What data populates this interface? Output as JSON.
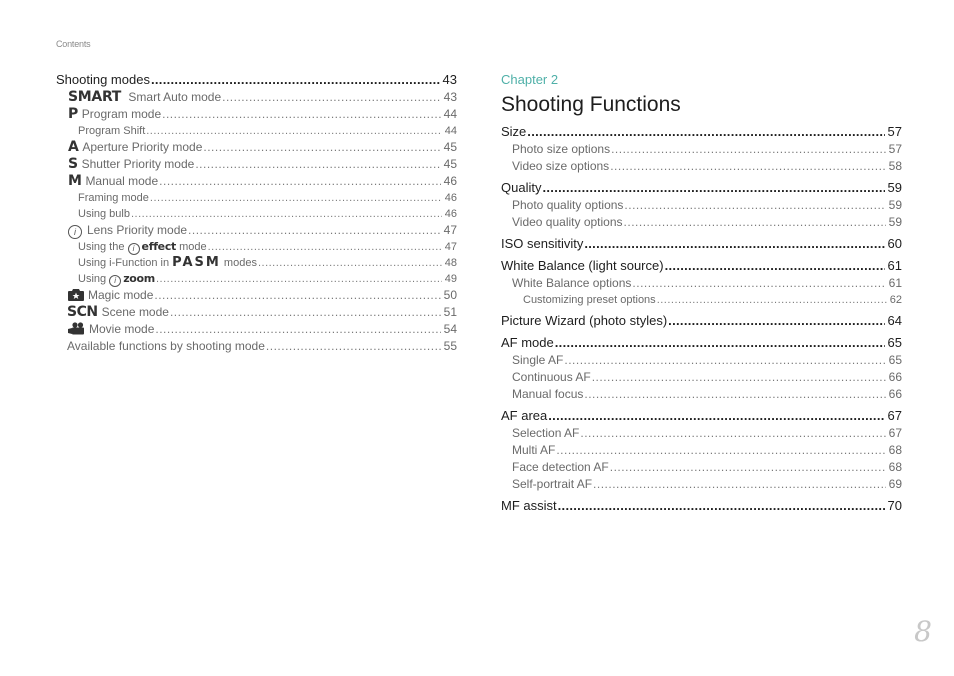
{
  "header": {
    "label": "Contents"
  },
  "left": {
    "heading": {
      "label": "Shooting modes",
      "page": "43"
    },
    "items": {
      "smart": {
        "icon": "SMART",
        "label": "Smart Auto mode",
        "page": "43"
      },
      "program": {
        "icon": "P",
        "label": "Program mode",
        "page": "44"
      },
      "shift": {
        "label": "Program Shift",
        "page": "44"
      },
      "aperture": {
        "icon": "A",
        "label": "Aperture Priority mode",
        "page": "45"
      },
      "shutter": {
        "icon": "S",
        "label": "Shutter Priority mode",
        "page": "45"
      },
      "manual": {
        "icon": "M",
        "label": "Manual mode",
        "page": "46"
      },
      "framing": {
        "label": "Framing mode",
        "page": "46"
      },
      "bulb": {
        "label": "Using bulb",
        "page": "46"
      },
      "lens": {
        "icon": "i",
        "label": "Lens Priority mode",
        "page": "47"
      },
      "effect": {
        "prefix": "Using the",
        "icon": "i",
        "bold": "effect",
        "suffix": "mode",
        "page": "47"
      },
      "ifunction": {
        "prefix": "Using i-Function in",
        "bold": "PASM",
        "suffix": "modes",
        "page": "48"
      },
      "zoom": {
        "prefix": "Using",
        "icon": "i",
        "bold": "zoom",
        "page": "49"
      },
      "magic": {
        "label": "Magic mode",
        "page": "50"
      },
      "scene": {
        "icon": "SCN",
        "label": "Scene mode",
        "page": "51"
      },
      "movie": {
        "label": "Movie mode",
        "page": "54"
      },
      "available": {
        "label": "Available functions by shooting mode",
        "page": "55"
      }
    }
  },
  "right": {
    "chapter_label": "Chapter 2",
    "chapter_title": "Shooting Functions",
    "accent_color": "#4fb0a8",
    "sections": [
      {
        "label": "Size",
        "page": "57",
        "children": [
          {
            "label": "Photo size options",
            "page": "57"
          },
          {
            "label": "Video size options",
            "page": "58"
          }
        ]
      },
      {
        "label": "Quality",
        "page": "59",
        "children": [
          {
            "label": "Photo quality options",
            "page": "59"
          },
          {
            "label": "Video quality options",
            "page": "59"
          }
        ]
      },
      {
        "label": "ISO sensitivity",
        "page": "60",
        "children": []
      },
      {
        "label": "White Balance (light source)",
        "page": "61",
        "children": [
          {
            "label": "White Balance options",
            "page": "61"
          },
          {
            "label": "Customizing preset options",
            "page": "62"
          }
        ]
      },
      {
        "label": "Picture Wizard (photo styles)",
        "page": "64",
        "children": []
      },
      {
        "label": "AF mode",
        "page": "65",
        "children": [
          {
            "label": "Single AF",
            "page": "65"
          },
          {
            "label": "Continuous AF",
            "page": "66"
          },
          {
            "label": "Manual focus",
            "page": "66"
          }
        ]
      },
      {
        "label": "AF area",
        "page": "67",
        "children": [
          {
            "label": "Selection AF",
            "page": "67"
          },
          {
            "label": "Multi AF",
            "page": "68"
          },
          {
            "label": "Face detection AF",
            "page": "68"
          },
          {
            "label": "Self-portrait AF",
            "page": "69"
          }
        ]
      },
      {
        "label": "MF assist",
        "page": "70",
        "children": []
      }
    ]
  },
  "footer": {
    "page_number": "8"
  }
}
